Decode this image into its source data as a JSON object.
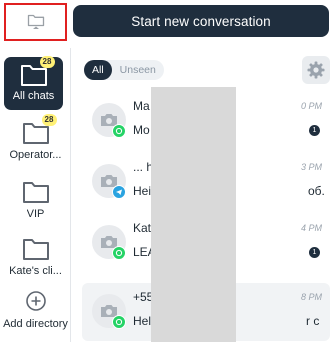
{
  "toolbar": {
    "start_label": "Start new conversation"
  },
  "directories": [
    {
      "label": "All chats",
      "badge": "28",
      "active": true
    },
    {
      "label": "Operator...",
      "badge": "28"
    },
    {
      "label": "VIP"
    },
    {
      "label": "Kate's cli..."
    },
    {
      "label": "Add directory"
    }
  ],
  "filters": [
    {
      "label": "All",
      "active": true
    },
    {
      "label": "Unseen"
    }
  ],
  "conversations": [
    {
      "name": "Ma",
      "time": "0 PM",
      "preview": "Mo",
      "channel": "whatsapp",
      "unread": "1"
    },
    {
      "name": "... h",
      "time": "3 PM",
      "preview": "Hei",
      "preview_tail": "об.",
      "channel": "telegram"
    },
    {
      "name": "Kat",
      "time": "4 PM",
      "preview": "LEA",
      "channel": "whatsapp",
      "unread": "1"
    },
    {
      "name": "+55",
      "time": "8 PM",
      "preview": "Hel",
      "preview_tail": "r c",
      "channel": "whatsapp",
      "selected": true
    }
  ],
  "colors": {
    "primary": "#1f2e3e",
    "badge": "#fff176",
    "whatsapp": "#25d366",
    "telegram": "#2aa3e0",
    "highlight": "#e02020"
  },
  "icons": {
    "toggle": "folder-icon",
    "settings": "gear-icon",
    "avatar": "camera-icon",
    "add": "plus-circle-icon"
  }
}
